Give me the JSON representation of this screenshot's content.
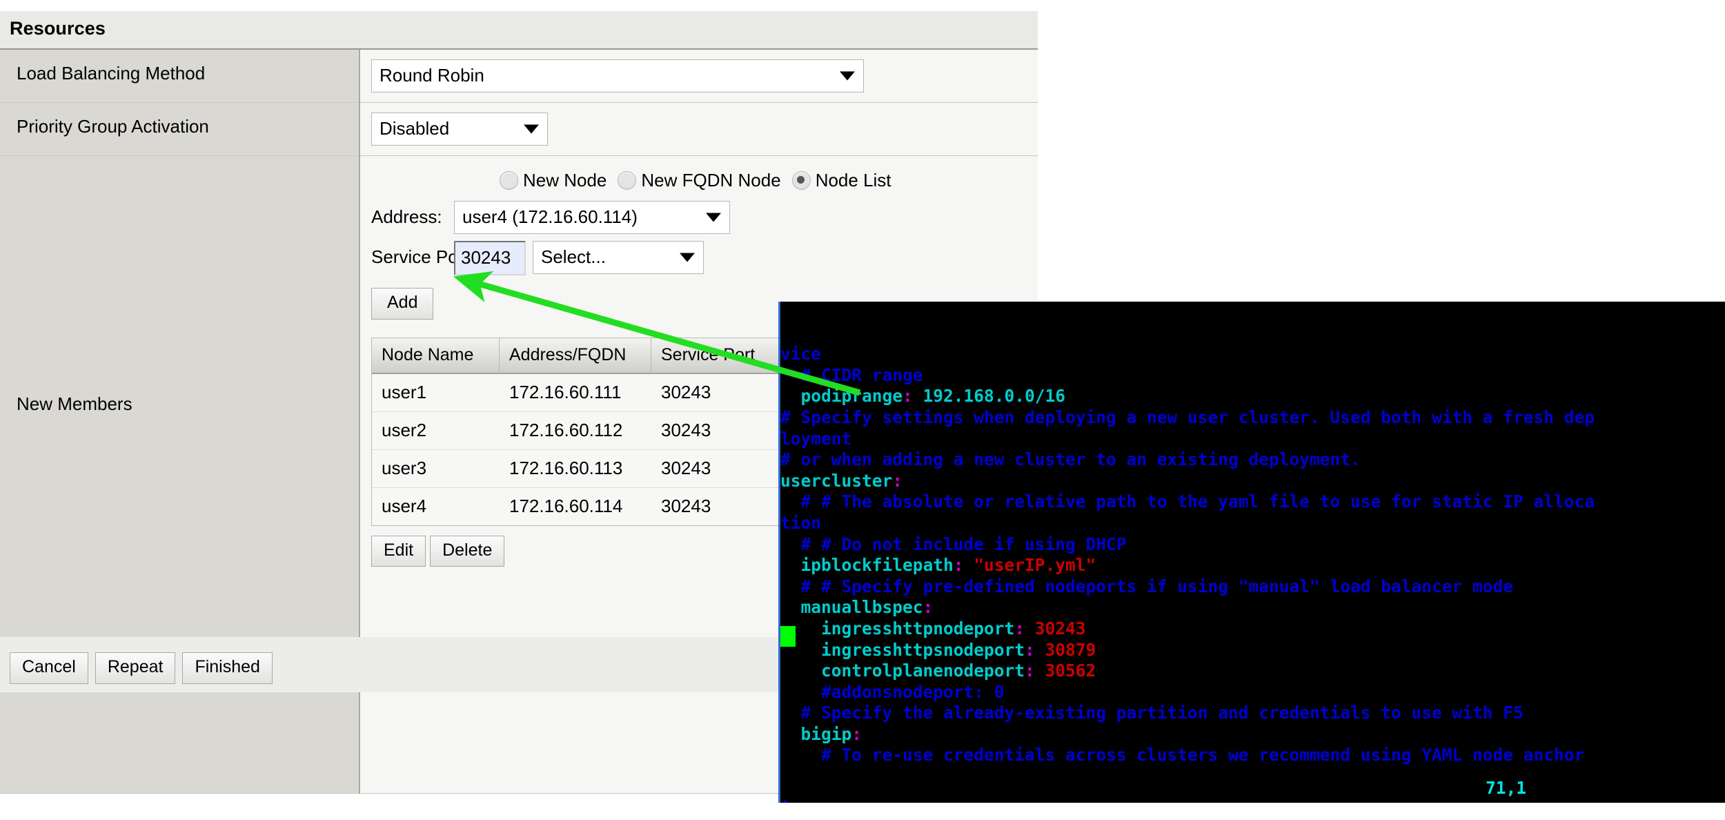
{
  "panel": {
    "title": "Resources",
    "rows": {
      "load_balancing_label": "Load Balancing Method",
      "load_balancing_value": "Round Robin",
      "priority_group_label": "Priority Group Activation",
      "priority_group_value": "Disabled",
      "new_members_label": "New Members"
    },
    "member_source": {
      "options": [
        {
          "label": "New Node",
          "selected": false
        },
        {
          "label": "New FQDN Node",
          "selected": false
        },
        {
          "label": "Node List",
          "selected": true
        }
      ],
      "address_caption": "Address:",
      "address_value": "user4 (172.16.60.114)",
      "service_port_caption": "Service Port:",
      "service_port_value": "30243",
      "service_port_select_value": "Select...",
      "add_label": "Add"
    },
    "members_table": {
      "headers": [
        "Node Name",
        "Address/FQDN",
        "Service Port"
      ],
      "rows": [
        {
          "node": "user1",
          "address": "172.16.60.111",
          "port": "30243"
        },
        {
          "node": "user2",
          "address": "172.16.60.112",
          "port": "30243"
        },
        {
          "node": "user3",
          "address": "172.16.60.113",
          "port": "30243"
        },
        {
          "node": "user4",
          "address": "172.16.60.114",
          "port": "30243"
        }
      ],
      "edit_label": "Edit",
      "delete_label": "Delete"
    },
    "actions": {
      "cancel_label": "Cancel",
      "repeat_label": "Repeat",
      "finished_label": "Finished"
    }
  },
  "terminal": {
    "status_line": "71,1",
    "lines": [
      [
        {
          "t": "vice",
          "c": "c-cmt"
        }
      ],
      [
        {
          "t": "  # CIDR range",
          "c": "c-cmt"
        }
      ],
      [
        {
          "t": "  podiprange",
          "c": "c-key"
        },
        {
          "t": ":",
          "c": "c-punc"
        },
        {
          "t": " 192.168.0.0/16",
          "c": "c-val"
        }
      ],
      [
        {
          "t": "# Specify settings when deploying a new user cluster. Used both with a fresh dep",
          "c": "c-cmt"
        }
      ],
      [
        {
          "t": "loyment",
          "c": "c-cmt"
        }
      ],
      [
        {
          "t": "# or when adding a new cluster to an existing deployment.",
          "c": "c-cmt"
        }
      ],
      [
        {
          "t": "usercluster",
          "c": "c-key"
        },
        {
          "t": ":",
          "c": "c-punc"
        }
      ],
      [
        {
          "t": "  # # The absolute or relative path to the yaml file to use for static IP alloca",
          "c": "c-cmt"
        }
      ],
      [
        {
          "t": "tion",
          "c": "c-cmt"
        }
      ],
      [
        {
          "t": "  # # Do not include if using DHCP",
          "c": "c-cmt"
        }
      ],
      [
        {
          "t": "  ipblockfilepath",
          "c": "c-key"
        },
        {
          "t": ":",
          "c": "c-punc"
        },
        {
          "t": " ",
          "c": "c-val"
        },
        {
          "t": "\"userIP.yml\"",
          "c": "c-num"
        }
      ],
      [
        {
          "t": "  # # Specify pre-defined nodeports if using \"manual\" load balancer mode",
          "c": "c-cmt"
        }
      ],
      [
        {
          "t": "  manuallbspec",
          "c": "c-key"
        },
        {
          "t": ":",
          "c": "c-punc"
        }
      ],
      [
        {
          "t": "    ingresshttpnodeport",
          "c": "c-key"
        },
        {
          "t": ":",
          "c": "c-punc"
        },
        {
          "t": " ",
          "c": "c-num"
        },
        {
          "t": "30243",
          "c": "c-num"
        }
      ],
      [
        {
          "t": "    ingresshttpsnodeport",
          "c": "c-key"
        },
        {
          "t": ":",
          "c": "c-punc"
        },
        {
          "t": " ",
          "c": "c-num"
        },
        {
          "t": "30879",
          "c": "c-num"
        }
      ],
      [
        {
          "t": "    controlplanenodeport",
          "c": "c-key"
        },
        {
          "t": ":",
          "c": "c-punc"
        },
        {
          "t": " ",
          "c": "c-num"
        },
        {
          "t": "30562",
          "c": "c-num"
        }
      ],
      [
        {
          "t": "    #addonsnodeport: 0",
          "c": "c-cmt"
        }
      ],
      [
        {
          "t": "  # Specify the already-existing partition and credentials to use with F5",
          "c": "c-cmt"
        }
      ],
      [
        {
          "t": "  bigip",
          "c": "c-key"
        },
        {
          "t": ":",
          "c": "c-punc"
        }
      ],
      [
        {
          "t": "    # To re-use credentials across clusters we recommend using YAML node anchor",
          "c": "c-cmt"
        }
      ],
      [
        {
          "t": "",
          "c": "c-cmt"
        }
      ],
      [
        {
          "t": ".",
          "c": "c-cmt"
        }
      ]
    ]
  },
  "annotation": {
    "arrow_color": "#22dd22",
    "arrow_name": "green-callout-arrow"
  }
}
